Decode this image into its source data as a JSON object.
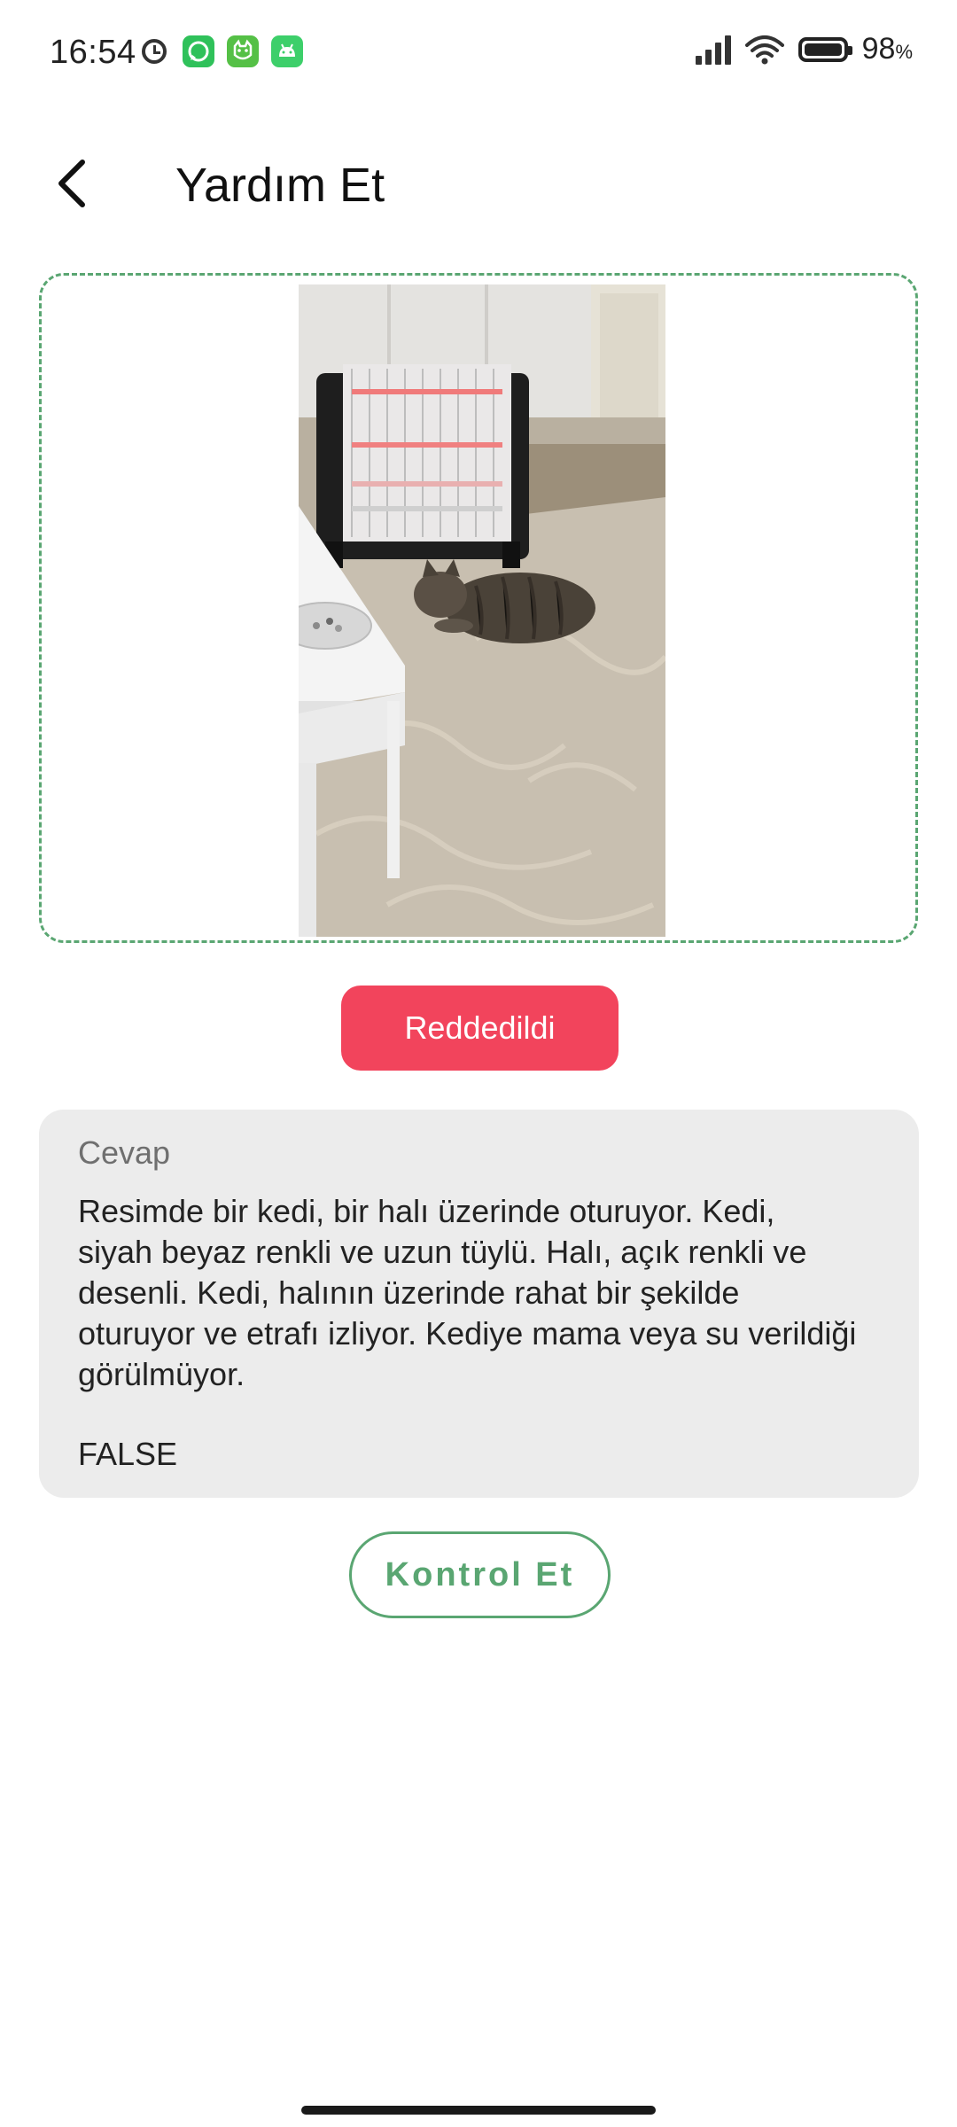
{
  "status_bar": {
    "time": "16:54",
    "battery_percent": "98",
    "battery_unit": "%",
    "icons": [
      "clock-icon",
      "whatsapp-icon",
      "cat-app-icon",
      "android-icon",
      "signal-icon",
      "wifi-icon",
      "battery-icon"
    ]
  },
  "header": {
    "back_icon": "chevron-left-icon",
    "title": "Yardım Et"
  },
  "photo": {
    "description_icon": "photo-cat-on-rug"
  },
  "status_button": {
    "label": "Reddedildi",
    "color": "#f2445c"
  },
  "answer": {
    "label": "Cevap",
    "text": "Resimde bir kedi, bir halı üzerinde oturuyor. Kedi, siyah beyaz renkli ve uzun tüylü. Halı, açık renkli ve desenli. Kedi, halının üzerinde rahat bir şekilde oturuyor ve etrafı izliyor. Kediye mama veya su verildiği görülmüyor.",
    "result": "FALSE"
  },
  "check_button": {
    "label": "Kontrol Et",
    "color": "#5aa672"
  },
  "colors": {
    "accent_green": "#5aa672",
    "reject_red": "#f2445c",
    "card_bg": "#ececec"
  }
}
